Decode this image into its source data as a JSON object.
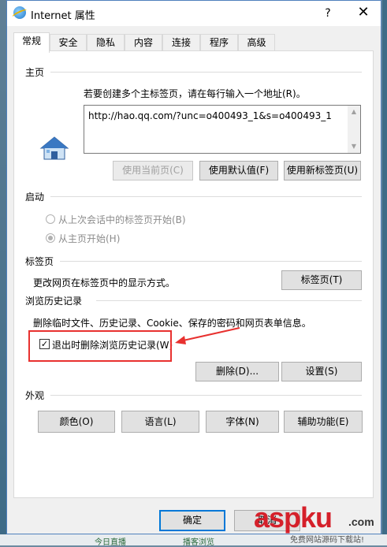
{
  "window": {
    "title": "Internet 属性",
    "help": "?",
    "close": "✕"
  },
  "tabs": [
    "常规",
    "安全",
    "隐私",
    "内容",
    "连接",
    "程序",
    "高级"
  ],
  "homepage": {
    "section": "主页",
    "instruction": "若要创建多个主标签页，请在每行输入一个地址(R)。",
    "url": "http://hao.qq.com/?unc=o400493_1&s=o400493_1",
    "btn_current": "使用当前页(C)",
    "btn_default": "使用默认值(F)",
    "btn_newtab": "使用新标签页(U)"
  },
  "startup": {
    "section": "启动",
    "option_last": "从上次会话中的标签页开始(B)",
    "option_home": "从主页开始(H)"
  },
  "tabs_section": {
    "section": "标签页",
    "desc": "更改网页在标签页中的显示方式。",
    "btn": "标签页(T)"
  },
  "history": {
    "section": "浏览历史记录",
    "desc": "删除临时文件、历史记录、Cookie、保存的密码和网页表单信息。",
    "checkbox_label": "退出时删除浏览历史记录(W)",
    "checkbox_checked": true,
    "btn_delete": "删除(D)...",
    "btn_settings": "设置(S)"
  },
  "appearance": {
    "section": "外观",
    "btn_colors": "颜色(O)",
    "btn_languages": "语言(L)",
    "btn_fonts": "字体(N)",
    "btn_accessibility": "辅助功能(E)"
  },
  "footer": {
    "ok": "确定",
    "cancel": "取消"
  },
  "background": {
    "bottom_text_1": "今日直播",
    "bottom_text_2": "播客浏览"
  },
  "watermark": {
    "brand": "aspku",
    "domain": ".com",
    "tagline": "免费网站源码下载站!"
  },
  "colors": {
    "accent": "#0078d7",
    "annotation": "#e8312f"
  }
}
